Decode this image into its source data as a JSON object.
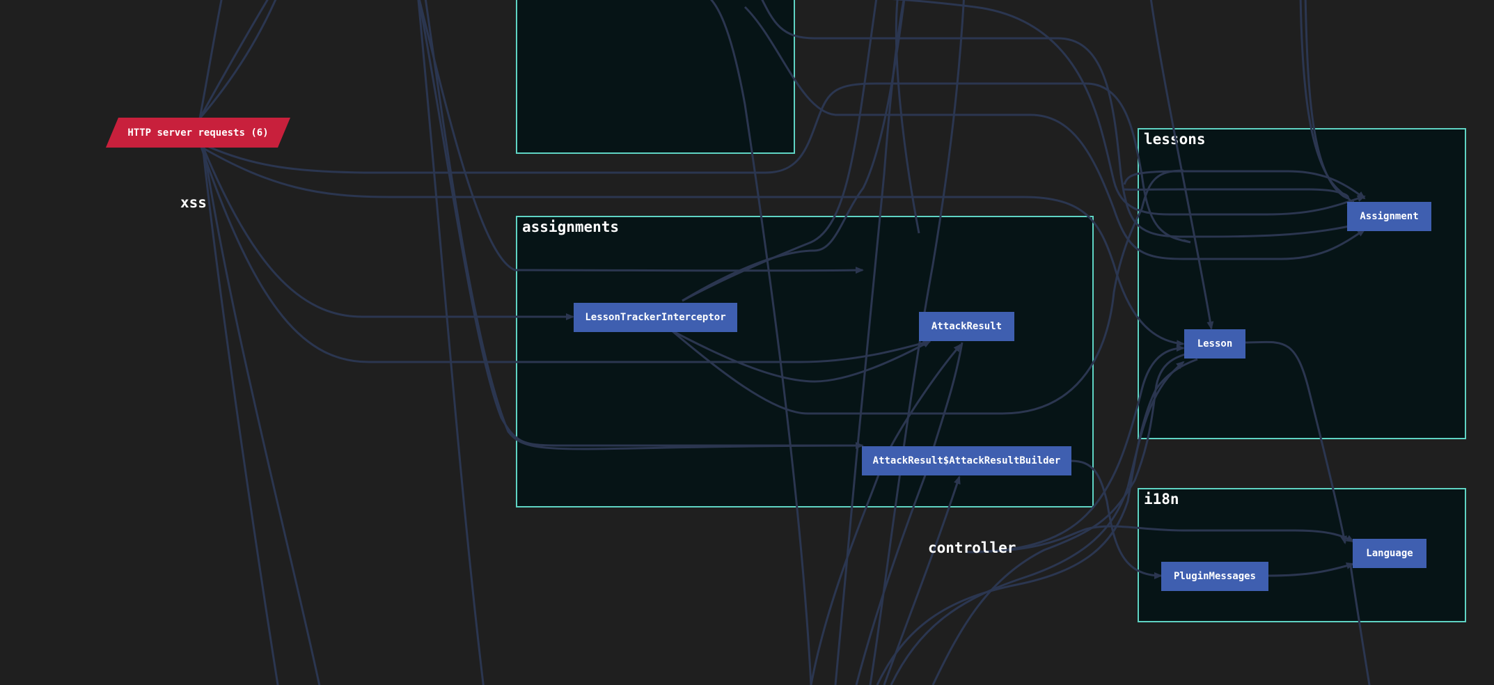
{
  "colors": {
    "background": "#1f1f1f",
    "cluster_border": "#5fd4c4",
    "cluster_fill": "#061416",
    "node_fill": "#3f5fb0",
    "entry_node_fill": "#c8203c",
    "edge": "#2b3650",
    "text": "#ffffff"
  },
  "entry_node": {
    "label": "HTTP server requests (6)",
    "shape": "parallelogram"
  },
  "free_labels": {
    "xss": "xss",
    "controller": "controller"
  },
  "clusters": {
    "assignments": {
      "label": "assignments",
      "nodes": {
        "lesson_tracker_interceptor": "LessonTrackerInterceptor",
        "attack_result": "AttackResult",
        "attack_result_builder": "AttackResult$AttackResultBuilder"
      }
    },
    "lessons": {
      "label": "lessons",
      "nodes": {
        "assignment": "Assignment",
        "lesson": "Lesson"
      }
    },
    "i18n": {
      "label": "i18n",
      "nodes": {
        "language": "Language",
        "plugin_messages": "PluginMessages"
      }
    },
    "top_unlabeled": {
      "label": ""
    }
  },
  "edges": [
    {
      "from": "xss",
      "to": "LessonTrackerInterceptor"
    },
    {
      "from": "xss",
      "to": "AttackResult"
    },
    {
      "from": "xss",
      "to": "AttackResult$AttackResultBuilder"
    },
    {
      "from": "xss",
      "to": "Lesson"
    },
    {
      "from": "LessonTrackerInterceptor",
      "to": "AttackResult"
    },
    {
      "from": "LessonTrackerInterceptor",
      "to": "Lesson"
    },
    {
      "from": "LessonTrackerInterceptor",
      "to": "Assignment"
    },
    {
      "from": "AttackResult$AttackResultBuilder",
      "to": "PluginMessages"
    },
    {
      "from": "controller",
      "to": "Language"
    },
    {
      "from": "controller",
      "to": "AttackResult"
    },
    {
      "from": "controller",
      "to": "AttackResult$AttackResultBuilder"
    },
    {
      "from": "controller",
      "to": "Lesson"
    },
    {
      "from": "controller",
      "to": "Assignment"
    },
    {
      "from": "Lesson",
      "to": "Language"
    },
    {
      "from": "PluginMessages",
      "to": "Language"
    }
  ]
}
